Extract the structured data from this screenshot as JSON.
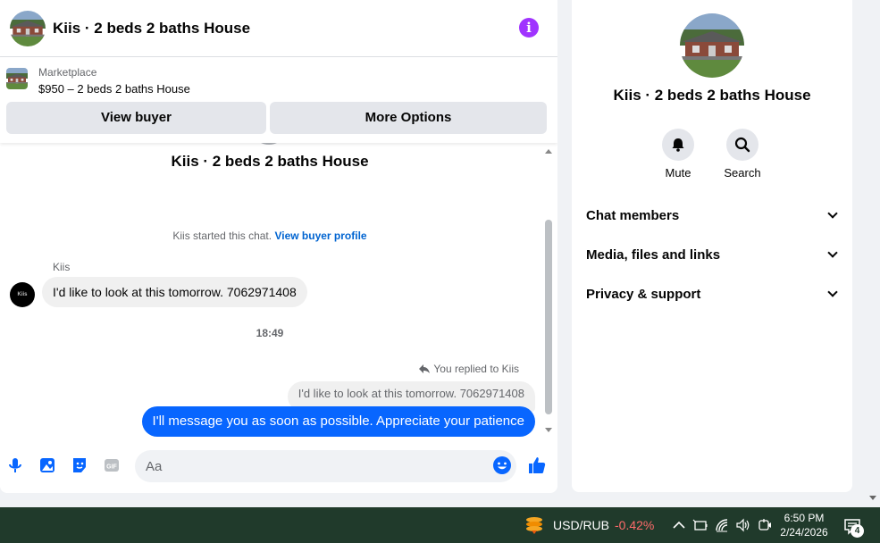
{
  "chat": {
    "title": "Kiis · 2 beds 2 baths House",
    "marketplace": {
      "label": "Marketplace",
      "listing": "$950 – 2 beds 2 baths House",
      "view_buyer_label": "View buyer",
      "more_options_label": "More Options"
    },
    "thread_title": "Kiis · 2 beds 2 baths House",
    "started_text": "Kiis started this chat.",
    "view_profile_link": "View buyer profile",
    "messages": [
      {
        "sender": "Kiis",
        "avatar_text": "Kiis",
        "text": "I'd like to look at this tomorrow. 7062971408"
      }
    ],
    "time_separator": "18:49",
    "reply": {
      "note": "You replied to Kiis",
      "quoted_text": "I'd like to look at this tomorrow. 7062971408",
      "text": "I'll message you as soon as possible. Appreciate your patience"
    },
    "composer": {
      "placeholder": "Aa"
    }
  },
  "info_panel": {
    "title": "Kiis · 2 beds 2 baths House",
    "actions": [
      {
        "label": "Mute",
        "icon": "bell-icon"
      },
      {
        "label": "Search",
        "icon": "search-icon"
      }
    ],
    "sections": [
      "Chat members",
      "Media, files and links",
      "Privacy & support"
    ]
  },
  "taskbar": {
    "ticker_pair": "USD/RUB",
    "ticker_change": "-0.42%",
    "time": "6:50 PM",
    "date": "2/24/2026",
    "notification_count": "4"
  },
  "colors": {
    "accent_blue": "#0866ff",
    "info_purple": "#a033ff",
    "taskbar_bg": "#203a2b",
    "negative_red": "#ff6b6b"
  }
}
